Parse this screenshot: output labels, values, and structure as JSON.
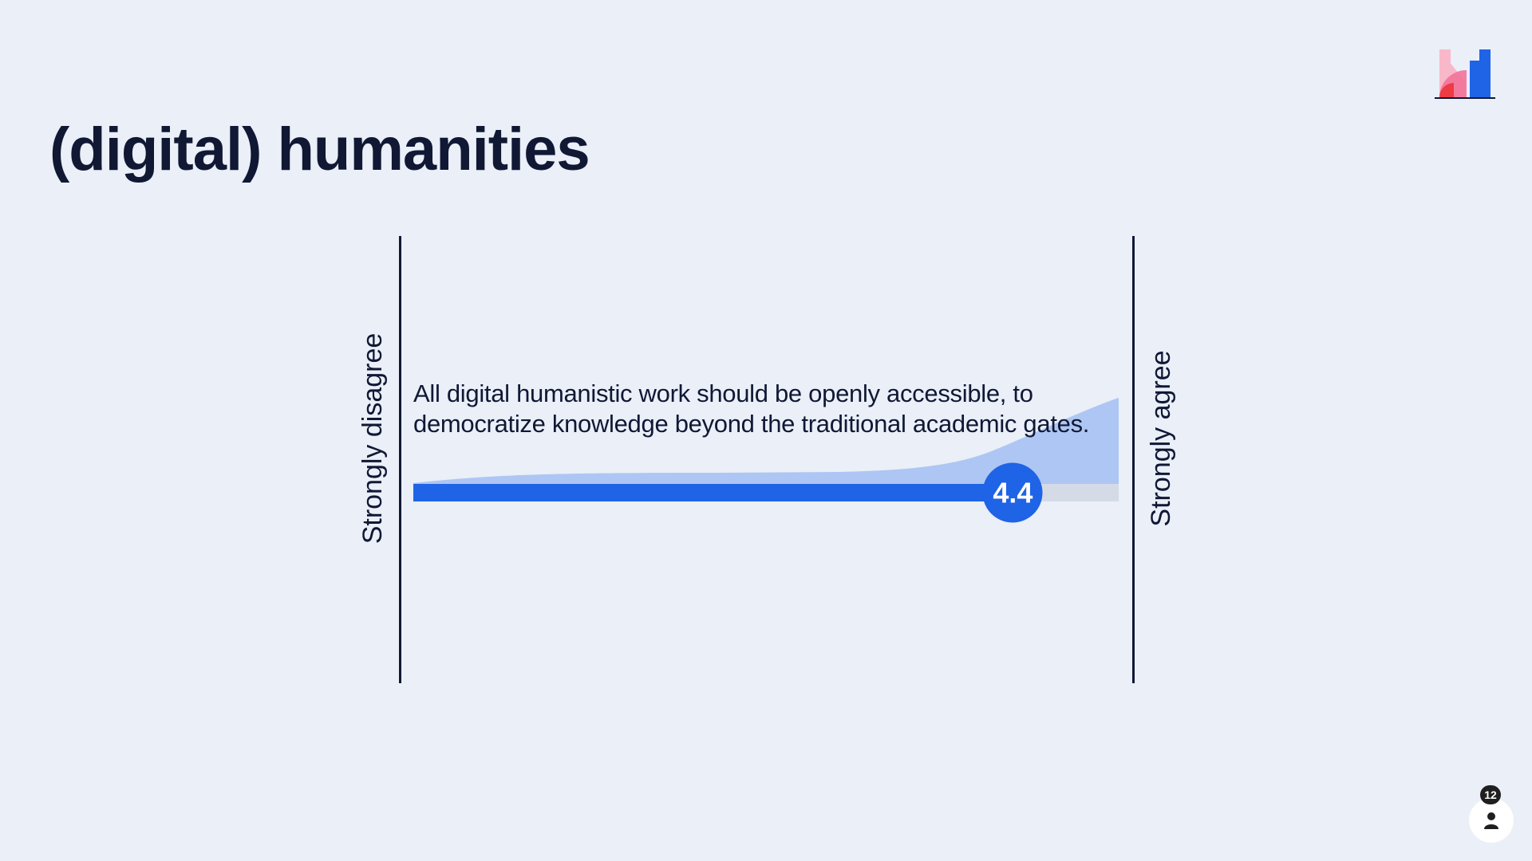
{
  "title": "(digital) humanities",
  "scale": {
    "min_label": "Strongly disagree",
    "max_label": "Strongly agree",
    "min": 1,
    "max": 5
  },
  "question": {
    "statement": "All digital humanistic work should be openly accessible, to democratize knowledge beyond the traditional academic gates.",
    "average_display": "4.4",
    "average": 4.4
  },
  "colors": {
    "accent": "#1f63e6",
    "distribution": "#aec6f3",
    "track": "#d5dbe6",
    "text": "#101834",
    "background": "#eaeff8"
  },
  "participants": {
    "count": "12",
    "icon": "person-icon"
  },
  "logo": {
    "icon": "mentimeter-logo-icon"
  }
}
